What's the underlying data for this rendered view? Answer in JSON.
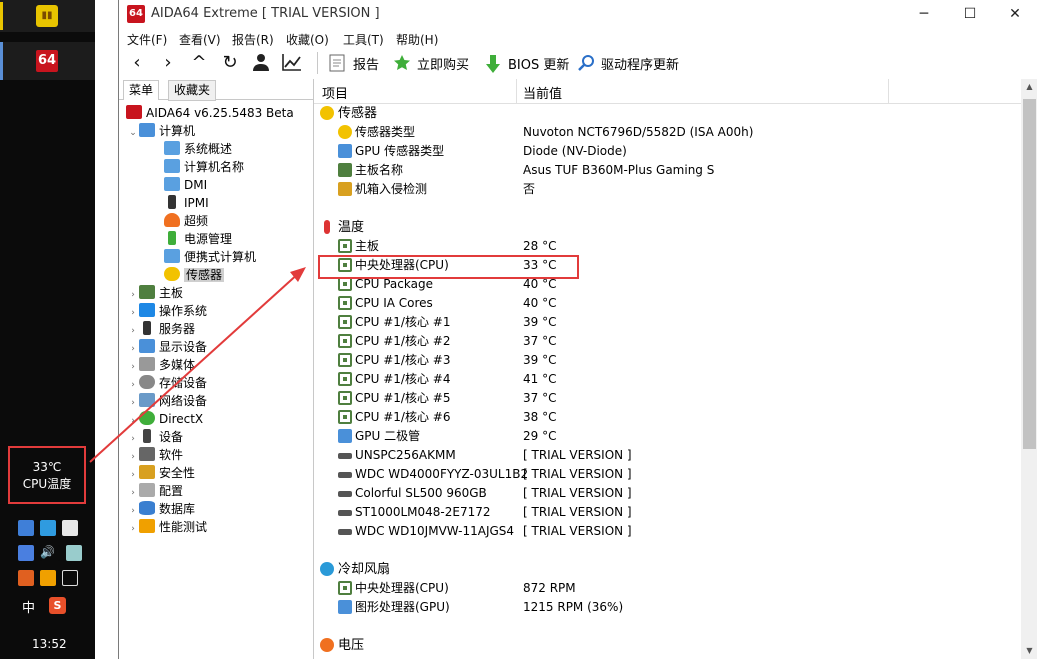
{
  "taskbar": {
    "temp_value": "33℃",
    "temp_label": "CPU温度",
    "lang": "中",
    "sogou": "S",
    "time": "13:52",
    "app2_icon": "64"
  },
  "window": {
    "icon_text": "64",
    "title": "AIDA64 Extreme  [ TRIAL VERSION ]",
    "minimize": "─",
    "maximize": "☐",
    "close": "✕"
  },
  "menu": [
    "文件(F)",
    "查看(V)",
    "报告(R)",
    "收藏(O)",
    "工具(T)",
    "帮助(H)"
  ],
  "toolbar": {
    "nav": [
      "‹",
      "›",
      "^",
      "↻",
      "user-icon",
      "chart-icon"
    ],
    "report": "报告",
    "buy": "立即购买",
    "bios": "BIOS 更新",
    "driver": "驱动程序更新"
  },
  "left_tabs": {
    "menu": "菜单",
    "favorites": "收藏夹"
  },
  "tree": {
    "root": "AIDA64 v6.25.5483 Beta",
    "computer": "计算机",
    "computer_children": [
      "系统概述",
      "计算机名称",
      "DMI",
      "IPMI",
      "超频",
      "电源管理",
      "便携式计算机",
      "传感器"
    ],
    "top_items": [
      "主板",
      "操作系统",
      "服务器",
      "显示设备",
      "多媒体",
      "存储设备",
      "网络设备",
      "DirectX",
      "设备",
      "软件",
      "安全性",
      "配置",
      "数据库",
      "性能测试"
    ]
  },
  "columns": {
    "item": "项目",
    "value": "当前值"
  },
  "sections": {
    "sensor": {
      "title": "传感器",
      "rows": [
        {
          "name": "传感器类型",
          "value": "Nuvoton NCT6796D/5582D  (ISA A00h)"
        },
        {
          "name": "GPU 传感器类型",
          "value": "Diode  (NV-Diode)"
        },
        {
          "name": "主板名称",
          "value": "Asus TUF B360M-Plus Gaming S"
        },
        {
          "name": "机箱入侵检测",
          "value": "否"
        }
      ]
    },
    "temperature": {
      "title": "温度",
      "rows": [
        {
          "name": "主板",
          "value": "28 °C"
        },
        {
          "name": "中央处理器(CPU)",
          "value": "33 °C"
        },
        {
          "name": "CPU Package",
          "value": "40 °C"
        },
        {
          "name": "CPU IA Cores",
          "value": "40 °C"
        },
        {
          "name": "CPU #1/核心 #1",
          "value": "39 °C"
        },
        {
          "name": "CPU #1/核心 #2",
          "value": "37 °C"
        },
        {
          "name": "CPU #1/核心 #3",
          "value": "39 °C"
        },
        {
          "name": "CPU #1/核心 #4",
          "value": "41 °C"
        },
        {
          "name": "CPU #1/核心 #5",
          "value": "37 °C"
        },
        {
          "name": "CPU #1/核心 #6",
          "value": "38 °C"
        },
        {
          "name": "GPU 二极管",
          "value": "29 °C"
        },
        {
          "name": "UNSPC256AKMM",
          "value": "[ TRIAL VERSION ]"
        },
        {
          "name": "WDC WD4000FYYZ-03UL1B2",
          "value": "[ TRIAL VERSION ]"
        },
        {
          "name": "Colorful SL500 960GB",
          "value": "[ TRIAL VERSION ]"
        },
        {
          "name": "ST1000LM048-2E7172",
          "value": "[ TRIAL VERSION ]"
        },
        {
          "name": "WDC WD10JMVW-11AJGS4",
          "value": "[ TRIAL VERSION ]"
        }
      ]
    },
    "fan": {
      "title": "冷却风扇",
      "rows": [
        {
          "name": "中央处理器(CPU)",
          "value": "872 RPM"
        },
        {
          "name": "图形处理器(GPU)",
          "value": "1215 RPM  (36%)"
        }
      ]
    },
    "voltage": {
      "title": "电压"
    }
  },
  "colors": {
    "annotation": "#e23b3b",
    "brand": "#c8141e",
    "selection": "#cfcfcf"
  }
}
